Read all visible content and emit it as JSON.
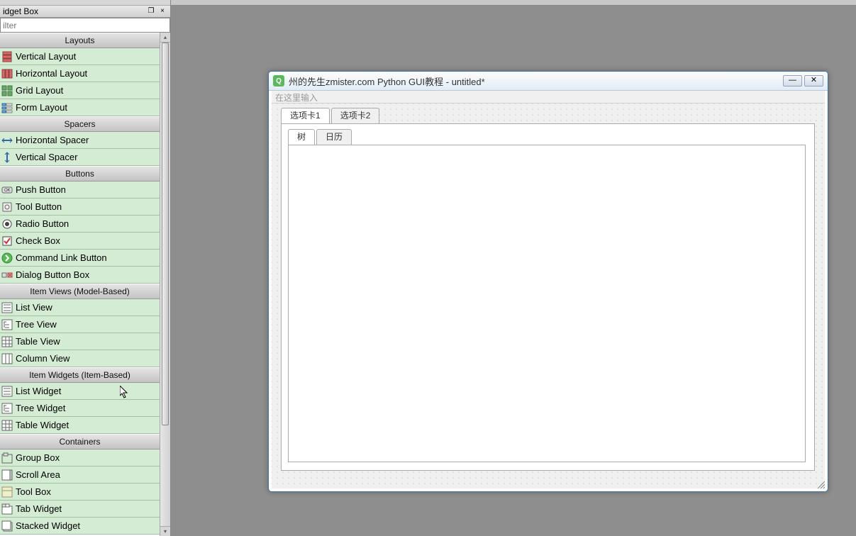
{
  "panel": {
    "title": "idget Box",
    "filter_placeholder": "ilter",
    "undock_label": "❐",
    "close_label": "×"
  },
  "categories": [
    {
      "name": "Layouts",
      "items": [
        {
          "label": "Vertical Layout",
          "icon": "vertical-layout-icon"
        },
        {
          "label": "Horizontal Layout",
          "icon": "horizontal-layout-icon"
        },
        {
          "label": "Grid Layout",
          "icon": "grid-layout-icon"
        },
        {
          "label": "Form Layout",
          "icon": "form-layout-icon"
        }
      ]
    },
    {
      "name": "Spacers",
      "items": [
        {
          "label": "Horizontal Spacer",
          "icon": "horizontal-spacer-icon"
        },
        {
          "label": "Vertical Spacer",
          "icon": "vertical-spacer-icon"
        }
      ]
    },
    {
      "name": "Buttons",
      "items": [
        {
          "label": "Push Button",
          "icon": "push-button-icon"
        },
        {
          "label": "Tool Button",
          "icon": "tool-button-icon"
        },
        {
          "label": "Radio Button",
          "icon": "radio-button-icon"
        },
        {
          "label": "Check Box",
          "icon": "check-box-icon"
        },
        {
          "label": "Command Link Button",
          "icon": "command-link-icon"
        },
        {
          "label": "Dialog Button Box",
          "icon": "dialog-button-box-icon"
        }
      ]
    },
    {
      "name": "Item Views (Model-Based)",
      "items": [
        {
          "label": "List View",
          "icon": "list-view-icon"
        },
        {
          "label": "Tree View",
          "icon": "tree-view-icon"
        },
        {
          "label": "Table View",
          "icon": "table-view-icon"
        },
        {
          "label": "Column View",
          "icon": "column-view-icon"
        }
      ]
    },
    {
      "name": "Item Widgets (Item-Based)",
      "items": [
        {
          "label": "List Widget",
          "icon": "list-view-icon"
        },
        {
          "label": "Tree Widget",
          "icon": "tree-view-icon"
        },
        {
          "label": "Table Widget",
          "icon": "table-view-icon"
        }
      ]
    },
    {
      "name": "Containers",
      "items": [
        {
          "label": "Group Box",
          "icon": "group-box-icon"
        },
        {
          "label": "Scroll Area",
          "icon": "scroll-area-icon"
        },
        {
          "label": "Tool Box",
          "icon": "tool-box-icon"
        },
        {
          "label": "Tab Widget",
          "icon": "tab-widget-icon"
        },
        {
          "label": "Stacked Widget",
          "icon": "stacked-widget-icon"
        }
      ]
    }
  ],
  "form": {
    "title": "州的先生zmister.com Python GUI教程 - untitled*",
    "menubar_hint": "在这里输入",
    "outer_tabs": [
      "选项卡1",
      "选项卡2"
    ],
    "inner_tabs": [
      "树",
      "日历"
    ]
  }
}
